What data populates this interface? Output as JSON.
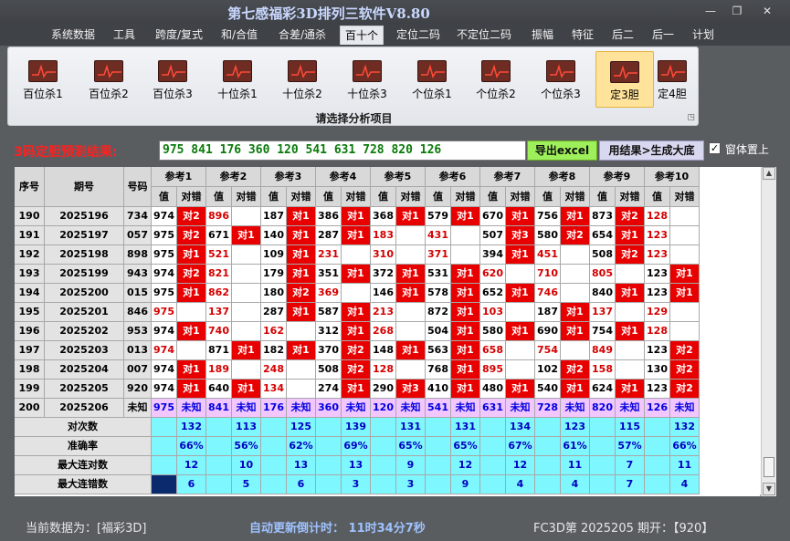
{
  "window": {
    "title": "第七感福彩3D排列三软件V8.80",
    "minimize": "—",
    "restore": "❐",
    "close": "✕"
  },
  "menu": [
    "系统数据",
    "工具",
    "跨度/复式",
    "和/合值",
    "合差/通杀",
    "百十个",
    "定位二码",
    "不定位二码",
    "振幅",
    "特征",
    "后二",
    "后一",
    "计划"
  ],
  "menu_active": "百十个",
  "ribbon": {
    "buttons": [
      "百位杀1",
      "百位杀2",
      "百位杀3",
      "十位杀1",
      "十位杀2",
      "十位杀3",
      "个位杀1",
      "个位杀2",
      "个位杀3",
      "定3胆",
      "定4胆"
    ],
    "selected": "定3胆",
    "group_label": "请选择分析项目",
    "launcher": "◳"
  },
  "prediction": {
    "label": "3码定胆预测结果:",
    "value": "975 841 176 360 120 541 631 728 820 126",
    "export_button": "导出excel",
    "generate_button": "用结果>生成大底",
    "topmost_label": "窗体置上",
    "topmost_checked": "✓"
  },
  "table": {
    "headers": {
      "seq": "序号",
      "issue": "期号",
      "num": "号码",
      "val": "值",
      "hit": "对错"
    },
    "groups": [
      "参考1",
      "参考2",
      "参考3",
      "参考4",
      "参考5",
      "参考6",
      "参考7",
      "参考8",
      "参考9",
      "参考10"
    ],
    "rows": [
      {
        "seq": "190",
        "issue": "2025196",
        "num": "734",
        "cells": [
          [
            "974",
            "对2"
          ],
          [
            "896",
            ""
          ],
          [
            "187",
            "对1"
          ],
          [
            "386",
            "对1"
          ],
          [
            "368",
            "对1"
          ],
          [
            "579",
            "对1"
          ],
          [
            "670",
            "对1"
          ],
          [
            "756",
            "对1"
          ],
          [
            "873",
            "对2"
          ],
          [
            "128",
            ""
          ]
        ]
      },
      {
        "seq": "191",
        "issue": "2025197",
        "num": "057",
        "cells": [
          [
            "975",
            "对2"
          ],
          [
            "671",
            "对1"
          ],
          [
            "140",
            "对1"
          ],
          [
            "287",
            "对1"
          ],
          [
            "183",
            ""
          ],
          [
            "431",
            ""
          ],
          [
            "507",
            "对3"
          ],
          [
            "580",
            "对2"
          ],
          [
            "654",
            "对1"
          ],
          [
            "123",
            ""
          ]
        ]
      },
      {
        "seq": "192",
        "issue": "2025198",
        "num": "898",
        "cells": [
          [
            "975",
            "对1"
          ],
          [
            "521",
            ""
          ],
          [
            "109",
            "对1"
          ],
          [
            "231",
            ""
          ],
          [
            "310",
            ""
          ],
          [
            "371",
            ""
          ],
          [
            "394",
            "对1"
          ],
          [
            "451",
            ""
          ],
          [
            "508",
            "对2"
          ],
          [
            "123",
            ""
          ]
        ]
      },
      {
        "seq": "193",
        "issue": "2025199",
        "num": "943",
        "cells": [
          [
            "974",
            "对2"
          ],
          [
            "821",
            ""
          ],
          [
            "179",
            "对1"
          ],
          [
            "351",
            "对1"
          ],
          [
            "372",
            "对1"
          ],
          [
            "531",
            "对1"
          ],
          [
            "620",
            ""
          ],
          [
            "710",
            ""
          ],
          [
            "805",
            ""
          ],
          [
            "123",
            "对1"
          ]
        ]
      },
      {
        "seq": "194",
        "issue": "2025200",
        "num": "015",
        "cells": [
          [
            "975",
            "对1"
          ],
          [
            "862",
            ""
          ],
          [
            "180",
            "对2"
          ],
          [
            "369",
            ""
          ],
          [
            "146",
            "对1"
          ],
          [
            "578",
            "对1"
          ],
          [
            "652",
            "对1"
          ],
          [
            "746",
            ""
          ],
          [
            "840",
            "对1"
          ],
          [
            "123",
            "对1"
          ]
        ]
      },
      {
        "seq": "195",
        "issue": "2025201",
        "num": "846",
        "cells": [
          [
            "975",
            ""
          ],
          [
            "137",
            ""
          ],
          [
            "287",
            "对1"
          ],
          [
            "587",
            "对1"
          ],
          [
            "213",
            ""
          ],
          [
            "872",
            "对1"
          ],
          [
            "103",
            ""
          ],
          [
            "187",
            "对1"
          ],
          [
            "137",
            ""
          ],
          [
            "129",
            ""
          ]
        ]
      },
      {
        "seq": "196",
        "issue": "2025202",
        "num": "953",
        "cells": [
          [
            "974",
            "对1"
          ],
          [
            "740",
            ""
          ],
          [
            "162",
            ""
          ],
          [
            "312",
            "对1"
          ],
          [
            "268",
            ""
          ],
          [
            "504",
            "对1"
          ],
          [
            "580",
            "对1"
          ],
          [
            "690",
            "对1"
          ],
          [
            "754",
            "对1"
          ],
          [
            "128",
            ""
          ]
        ]
      },
      {
        "seq": "197",
        "issue": "2025203",
        "num": "013",
        "cells": [
          [
            "974",
            ""
          ],
          [
            "871",
            "对1"
          ],
          [
            "182",
            "对1"
          ],
          [
            "370",
            "对2"
          ],
          [
            "148",
            "对1"
          ],
          [
            "563",
            "对1"
          ],
          [
            "658",
            ""
          ],
          [
            "754",
            ""
          ],
          [
            "849",
            ""
          ],
          [
            "123",
            "对2"
          ]
        ]
      },
      {
        "seq": "198",
        "issue": "2025204",
        "num": "007",
        "cells": [
          [
            "974",
            "对1"
          ],
          [
            "189",
            ""
          ],
          [
            "248",
            ""
          ],
          [
            "508",
            "对2"
          ],
          [
            "128",
            ""
          ],
          [
            "768",
            "对1"
          ],
          [
            "895",
            ""
          ],
          [
            "102",
            "对2"
          ],
          [
            "158",
            ""
          ],
          [
            "130",
            "对2"
          ]
        ]
      },
      {
        "seq": "199",
        "issue": "2025205",
        "num": "920",
        "cells": [
          [
            "974",
            "对1"
          ],
          [
            "640",
            "对1"
          ],
          [
            "134",
            ""
          ],
          [
            "274",
            "对1"
          ],
          [
            "290",
            "对3"
          ],
          [
            "410",
            "对1"
          ],
          [
            "480",
            "对1"
          ],
          [
            "540",
            "对1"
          ],
          [
            "624",
            "对1"
          ],
          [
            "123",
            "对2"
          ]
        ]
      }
    ],
    "current": {
      "seq": "200",
      "issue": "2025206",
      "num": "未知",
      "values": [
        "975",
        "841",
        "176",
        "360",
        "120",
        "541",
        "631",
        "728",
        "820",
        "126"
      ],
      "status": "未知"
    },
    "stats": [
      {
        "label": "对次数",
        "values": [
          "132",
          "113",
          "125",
          "139",
          "131",
          "131",
          "134",
          "123",
          "115",
          "132"
        ]
      },
      {
        "label": "准确率",
        "values": [
          "66%",
          "56%",
          "62%",
          "69%",
          "65%",
          "65%",
          "67%",
          "61%",
          "57%",
          "66%"
        ]
      },
      {
        "label": "最大连对数",
        "values": [
          "12",
          "10",
          "13",
          "13",
          "9",
          "12",
          "12",
          "11",
          "7",
          "11"
        ]
      },
      {
        "label": "最大连错数",
        "values": [
          "6",
          "5",
          "6",
          "3",
          "3",
          "9",
          "4",
          "4",
          "7",
          "4"
        ]
      }
    ]
  },
  "statusbar": {
    "current_data": "当前数据为：[福彩3D]",
    "countdown": "自动更新倒计时：  11时34分7秒",
    "issue_info": "FC3D第 2025205 期开：【920】"
  },
  "colors": {
    "hit": "#e80000",
    "highlight_value": "#d40000",
    "predict_row": "#f2c6ff",
    "stats": "#7ff7ff"
  }
}
